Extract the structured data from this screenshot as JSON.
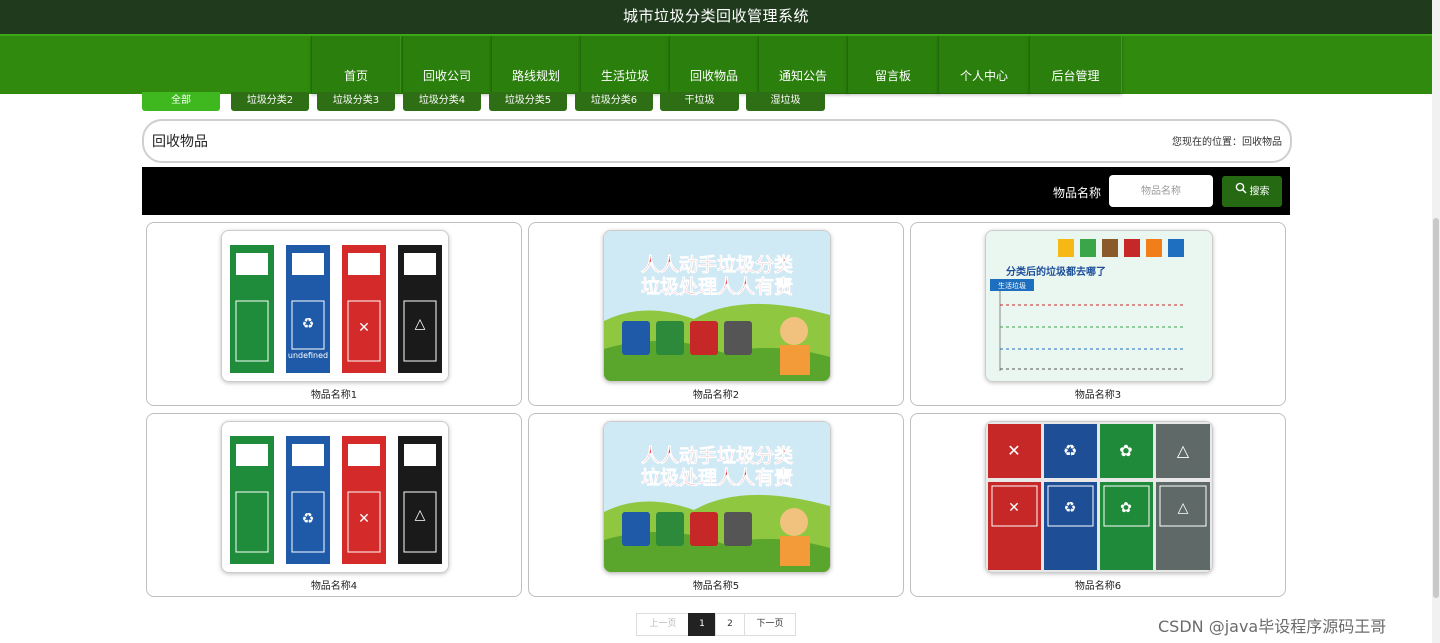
{
  "header": {
    "title": "城市垃圾分类回收管理系统"
  },
  "nav": {
    "items": [
      {
        "label": "首页"
      },
      {
        "label": "回收公司"
      },
      {
        "label": "路线规划"
      },
      {
        "label": "生活垃圾"
      },
      {
        "label": "回收物品"
      },
      {
        "label": "通知公告"
      },
      {
        "label": "留言板"
      },
      {
        "label": "个人中心"
      },
      {
        "label": "后台管理"
      }
    ]
  },
  "categories": [
    {
      "label": "全部",
      "active": true
    },
    {
      "label": "垃圾分类2"
    },
    {
      "label": "垃圾分类3"
    },
    {
      "label": "垃圾分类4"
    },
    {
      "label": "垃圾分类5"
    },
    {
      "label": "垃圾分类6"
    },
    {
      "label": "干垃圾"
    },
    {
      "label": "湿垃圾"
    }
  ],
  "breadcrumb": {
    "heading": "回收物品",
    "location": "您现在的位置：回收物品"
  },
  "search": {
    "label": "物品名称",
    "placeholder": "物品名称",
    "button": "搜索"
  },
  "items": [
    {
      "name": "物品名称1",
      "image": "four-bins"
    },
    {
      "name": "物品名称2",
      "image": "poster"
    },
    {
      "name": "物品名称3",
      "image": "infographic"
    },
    {
      "name": "物品名称4",
      "image": "four-bins"
    },
    {
      "name": "物品名称5",
      "image": "poster"
    },
    {
      "name": "物品名称6",
      "image": "sign-grid"
    }
  ],
  "images": {
    "bins_undefined": "undefined",
    "poster_line1": "人人动手垃圾分类",
    "poster_line2": "垃圾处理人人有责",
    "info_title": "分类后的垃圾都去哪了",
    "info_tag": "生活垃圾"
  },
  "pagination": {
    "prev": "上一页",
    "pages": [
      "1",
      "2"
    ],
    "current": "1",
    "next": "下一页"
  },
  "watermark": "CSDN @java毕设程序源码王哥"
}
